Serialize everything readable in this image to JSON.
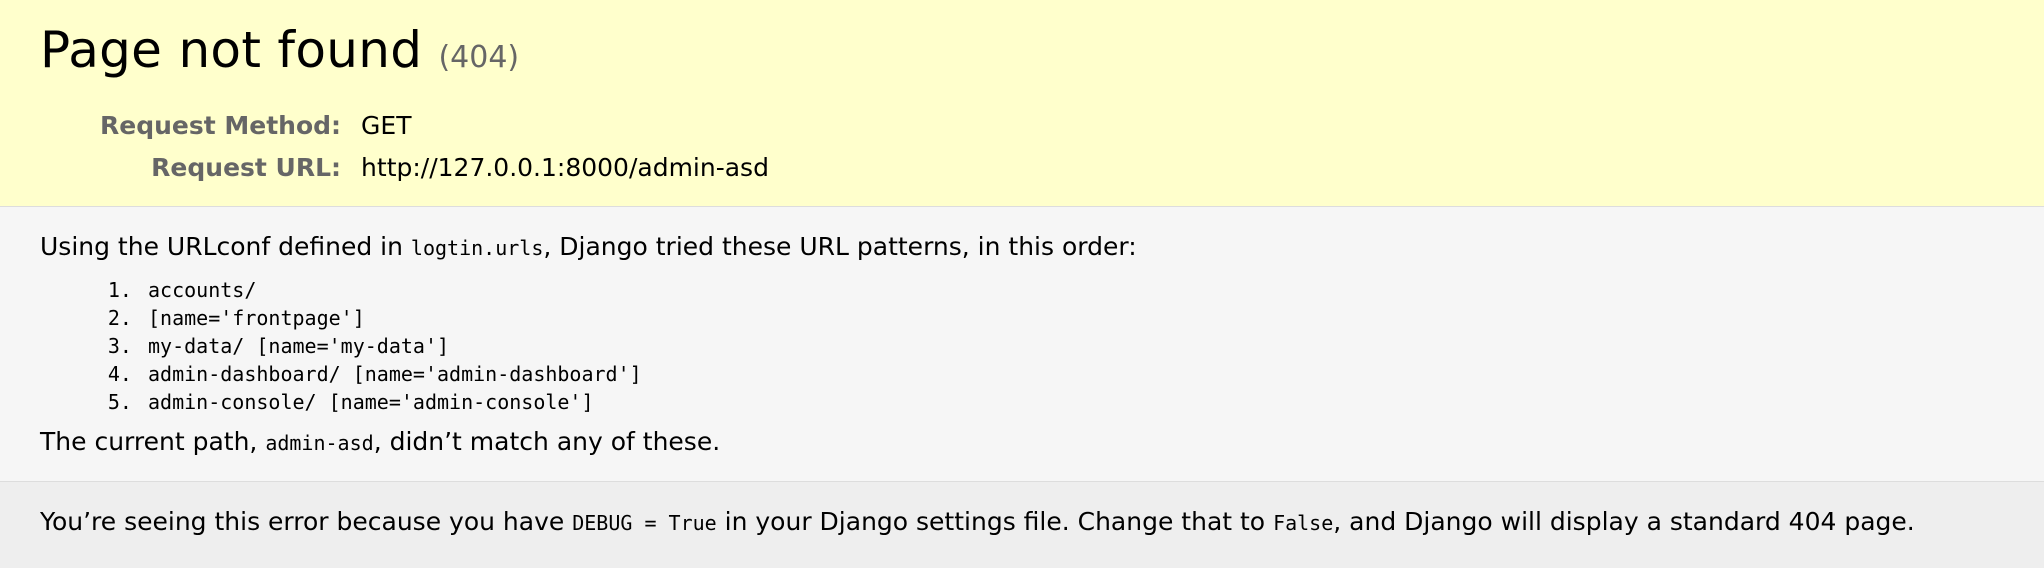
{
  "summary": {
    "title": "Page not found",
    "status_code": "(404)",
    "request_method_label": "Request Method:",
    "request_method_value": "GET",
    "request_url_label": "Request URL:",
    "request_url_value": "http://127.0.0.1:8000/admin-asd"
  },
  "info": {
    "urlconf_text_before": "Using the URLconf defined in ",
    "urlconf_module": "logtin.urls",
    "urlconf_text_after": ", Django tried these URL patterns, in this order:",
    "patterns": [
      "accounts/",
      "[name='frontpage']",
      "my-data/ [name='my-data']",
      "admin-dashboard/ [name='admin-dashboard']",
      "admin-console/ [name='admin-console']"
    ],
    "current_path_before": "The current path, ",
    "current_path": "admin-asd",
    "current_path_after": ", didn’t match any of these."
  },
  "explanation": {
    "text_before": "You’re seeing this error because you have ",
    "debug_setting": "DEBUG = True",
    "text_middle": " in your Django settings file. Change that to ",
    "false_value": "False",
    "text_after": ", and Django will display a standard 404 page."
  }
}
